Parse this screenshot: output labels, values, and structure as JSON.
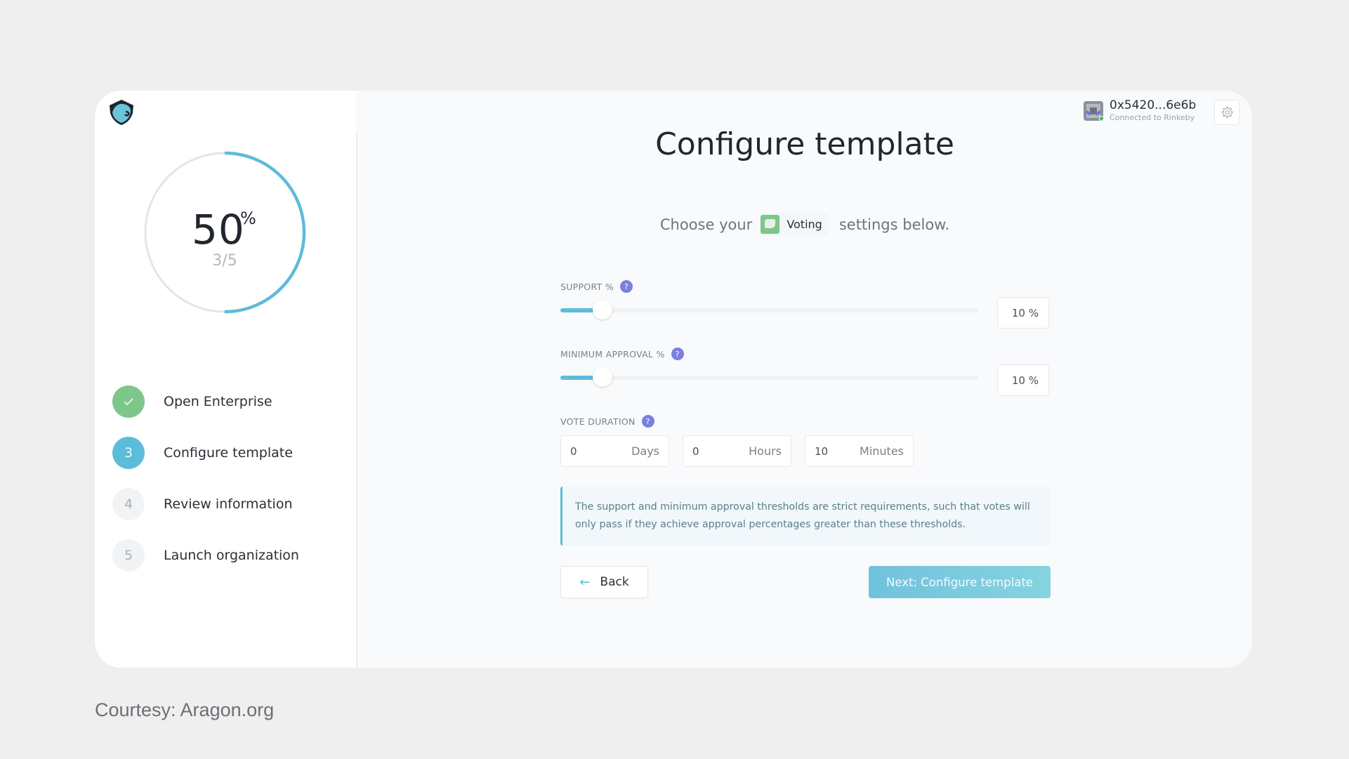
{
  "app": {
    "logo": "aragon-eagle-logo"
  },
  "progress": {
    "percent_value": 50,
    "percent_label": "50",
    "percent_sign": "%",
    "steps_label": "3/5",
    "fraction": 0.5,
    "colors": {
      "track": "#e3e6e9",
      "fill": "#5dbcd9"
    }
  },
  "steps": [
    {
      "number": "✓",
      "label": "Open Enterprise",
      "state": "done"
    },
    {
      "number": "3",
      "label": "Configure template",
      "state": "active"
    },
    {
      "number": "4",
      "label": "Review information",
      "state": "todo"
    },
    {
      "number": "5",
      "label": "Launch organization",
      "state": "todo"
    }
  ],
  "account": {
    "address": "0x5420...6e6b",
    "network": "Connected to Rinkeby",
    "icon": "identicon",
    "settings_icon": "gear-icon"
  },
  "main": {
    "title": "Configure template",
    "subtitle_before": "Choose your",
    "app_badge": "Voting",
    "subtitle_after": "settings below."
  },
  "form": {
    "support": {
      "label": "SUPPORT %",
      "help": "?",
      "value_percent": 10,
      "display": "10 %"
    },
    "min_approval": {
      "label": "MINIMUM APPROVAL %",
      "help": "?",
      "value_percent": 10,
      "display": "10 %"
    },
    "vote_duration": {
      "label": "VOTE DURATION",
      "help": "?",
      "fields": [
        {
          "value": "0",
          "unit": "Days"
        },
        {
          "value": "0",
          "unit": "Hours"
        },
        {
          "value": "10",
          "unit": "Minutes"
        }
      ]
    },
    "info": "The support and minimum approval thresholds are strict requirements, such that votes will only pass if they achieve approval percentages greater than these thresholds.",
    "back_label": "Back",
    "back_arrow": "←",
    "next_label": "Next: Configure template"
  },
  "footer": {
    "courtesy": "Courtesy: Aragon.org"
  }
}
